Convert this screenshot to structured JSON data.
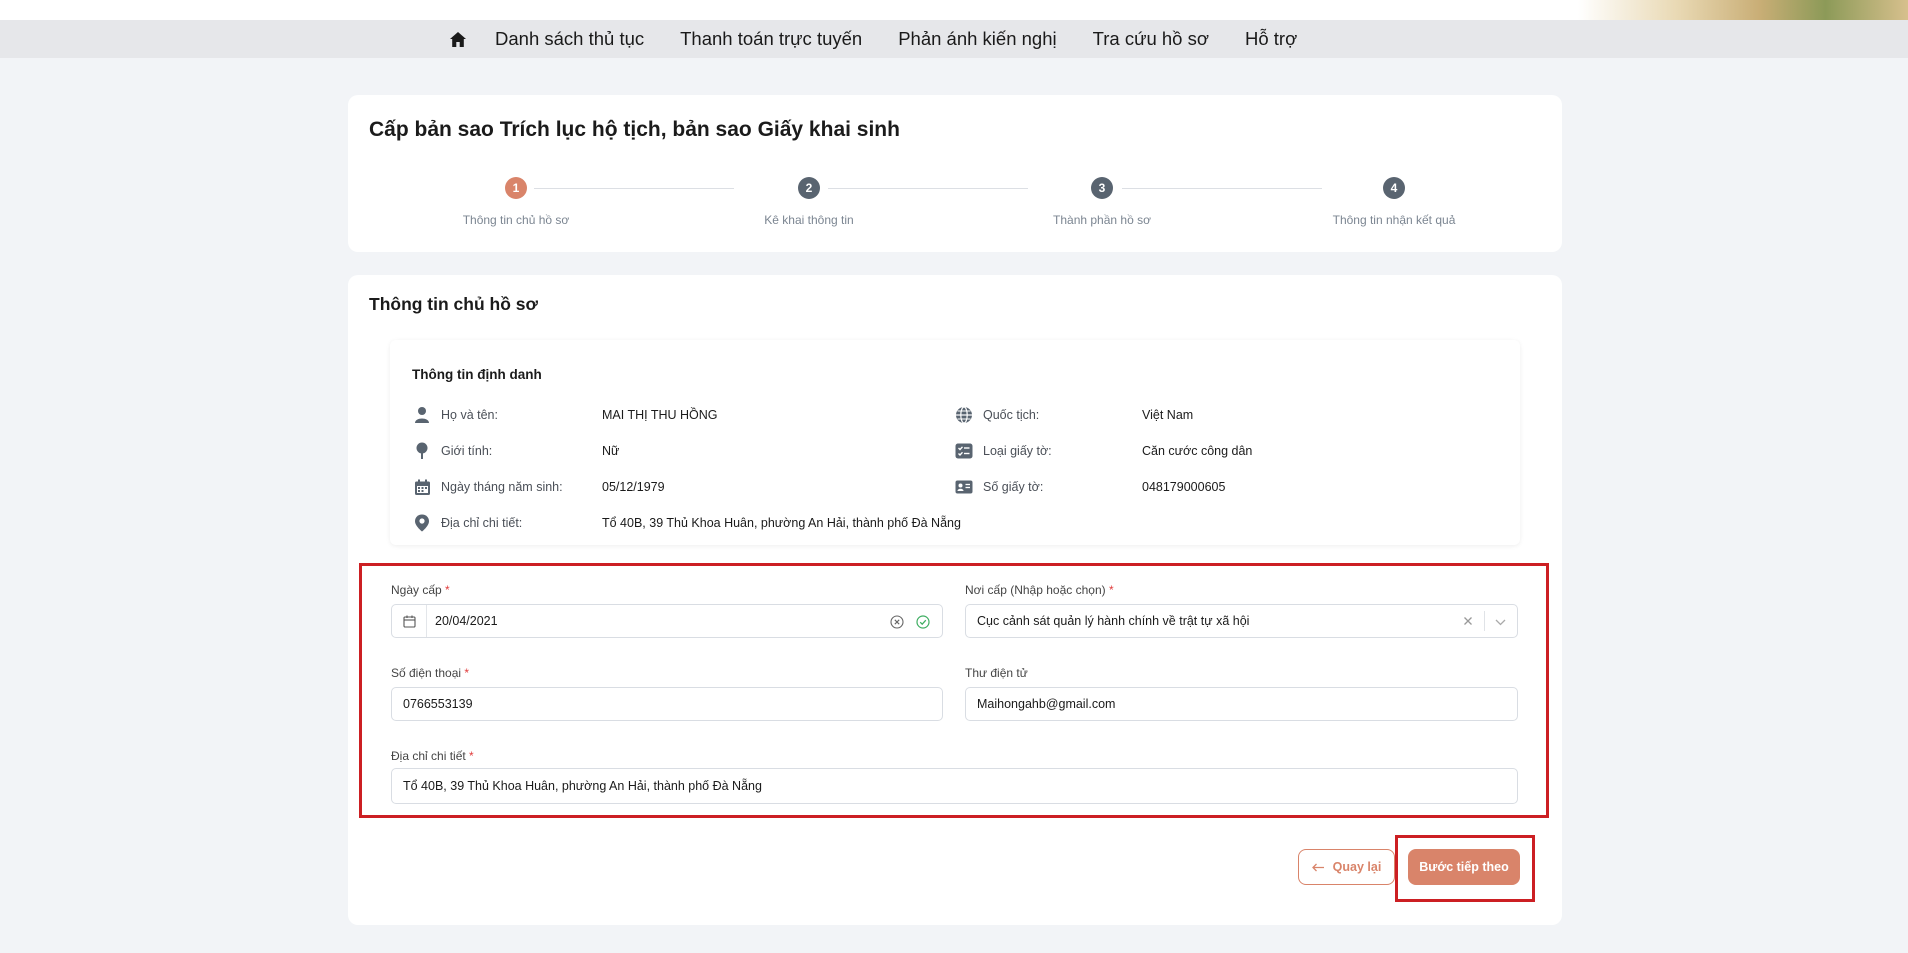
{
  "nav": {
    "home_icon": "home-icon",
    "items": [
      "Danh sách thủ tục",
      "Thanh toán trực tuyến",
      "Phản ánh kiến nghị",
      "Tra cứu hồ sơ",
      "Hỗ trợ"
    ]
  },
  "page": {
    "title": "Cấp bản sao Trích lục hộ tịch, bản sao Giấy khai sinh"
  },
  "stepper": {
    "active_step": 1,
    "steps": [
      {
        "number": "1",
        "label": "Thông tin chủ hồ sơ"
      },
      {
        "number": "2",
        "label": "Kê khai thông tin"
      },
      {
        "number": "3",
        "label": "Thành phần hồ sơ"
      },
      {
        "number": "4",
        "label": "Thông tin nhận kết quả"
      }
    ]
  },
  "section": {
    "title": "Thông tin chủ hồ sơ"
  },
  "identity": {
    "title": "Thông tin định danh",
    "name": {
      "label": "Họ và tên:",
      "value": "MAI THỊ THU HỒNG",
      "icon": "person-icon"
    },
    "gender": {
      "label": "Giới tính:",
      "value": "Nữ",
      "icon": "gender-icon"
    },
    "dob": {
      "label": "Ngày tháng năm sinh:",
      "value": "05/12/1979",
      "icon": "calendar-icon"
    },
    "address": {
      "label": "Địa chỉ chi tiết:",
      "value": "Tổ 40B, 39 Thủ Khoa Huân, phường An Hải, thành phố Đà Nẵng",
      "icon": "location-icon"
    },
    "nationality": {
      "label": "Quốc tịch:",
      "value": "Việt Nam",
      "icon": "globe-icon"
    },
    "doc_type": {
      "label": "Loại giấy tờ:",
      "value": "Căn cước công dân",
      "icon": "document-list-icon"
    },
    "doc_number": {
      "label": "Số giấy tờ:",
      "value": "048179000605",
      "icon": "id-card-icon"
    }
  },
  "form": {
    "issue_date": {
      "label": "Ngày cấp",
      "required": "*",
      "value": "20/04/2021"
    },
    "issue_place": {
      "label": "Nơi cấp (Nhập hoặc chọn)",
      "required": "*",
      "value": "Cục cảnh sát quản lý hành chính về trật tự xã hội"
    },
    "phone": {
      "label": "Số điện thoại",
      "required": "*",
      "value": "0766553139"
    },
    "email": {
      "label": "Thư điện tử",
      "value": "Maihongahb@gmail.com"
    },
    "address": {
      "label": "Địa chỉ chi tiết",
      "required": "*",
      "value": "Tổ 40B, 39 Thủ Khoa Huân, phường An Hải, thành phố Đà Nẵng"
    }
  },
  "buttons": {
    "back": "Quay lại",
    "next": "Bước tiếp theo"
  },
  "colors": {
    "accent": "#d9846a",
    "highlight": "#cc1f23",
    "step_inactive": "#596470"
  }
}
